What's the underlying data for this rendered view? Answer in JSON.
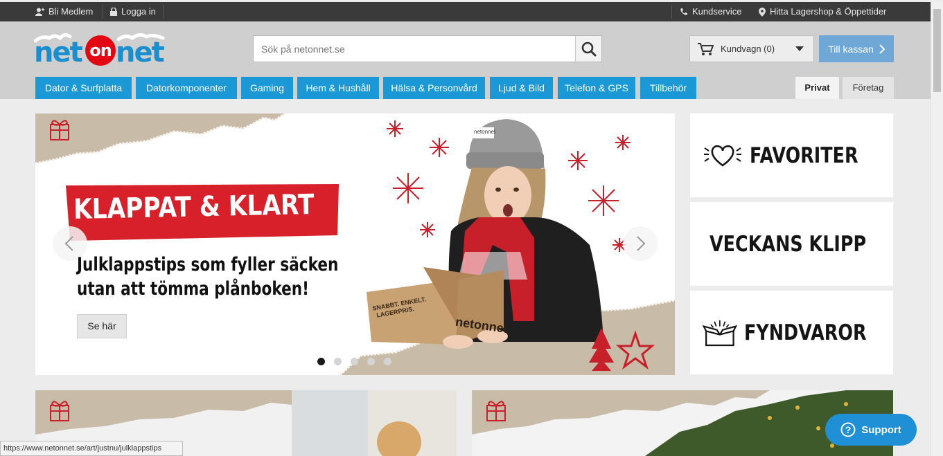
{
  "topbar": {
    "become_member": "Bli Medlem",
    "login": "Logga in",
    "customer_service": "Kundservice",
    "find_store": "Hitta Lagershop & Öppettider"
  },
  "header": {
    "search_placeholder": "Sök på netonnet.se",
    "cart_label": "Kundvagn (0)",
    "checkout_label": "Till kassan"
  },
  "nav": {
    "categories": [
      "Dator & Surfplatta",
      "Datorkomponenter",
      "Gaming",
      "Hem & Hushåll",
      "Hälsa & Personvård",
      "Ljud & Bild",
      "Telefon & GPS",
      "Tillbehör"
    ],
    "segments": [
      "Privat",
      "Företag"
    ],
    "active_segment": "Privat"
  },
  "hero": {
    "banner_title": "KLAPPAT & KLART",
    "subtitle_line1": "Julklappstips som fyller säcken",
    "subtitle_line2": "utan att tömma plånboken!",
    "cta": "Se här",
    "box_text_1": "SNABBT. ENKELT.",
    "box_text_2": "LAGERPRIS.",
    "box_brand": "netonnet",
    "hat_brand": "netonnet",
    "slide_count": 5,
    "active_slide": 1
  },
  "side_cards": [
    "FAVORITER",
    "VECKANS KLIPP",
    "FYNDVAROR"
  ],
  "status_url": "https://www.netonnet.se/art/justnu/julklappstips",
  "support_label": "Support",
  "colors": {
    "accent_blue": "#1a99d6",
    "brand_red": "#e30613",
    "topbar": "#3a3a3a",
    "checkout": "#6fa7d6"
  }
}
